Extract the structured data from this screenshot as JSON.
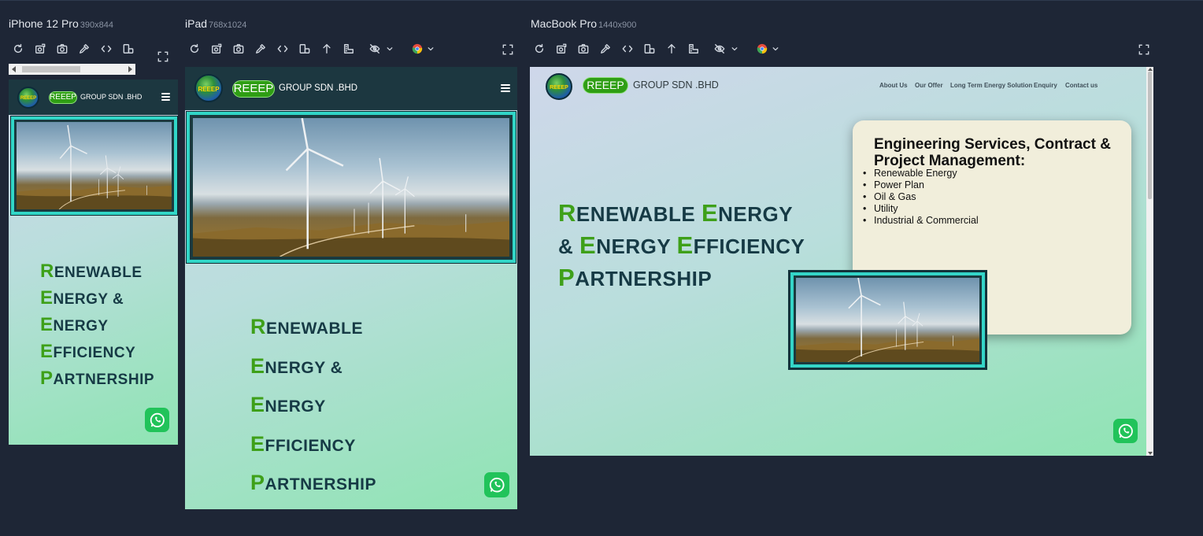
{
  "devices": [
    {
      "name": "iPhone 12 Pro",
      "resolution": "390x844"
    },
    {
      "name": "iPad",
      "resolution": "768x1024"
    },
    {
      "name": "MacBook Pro",
      "resolution": "1440x900"
    }
  ],
  "toolbar_icons": [
    "reload-icon",
    "screenshot-full-icon",
    "camera-icon",
    "eyedropper-icon",
    "code-icon",
    "rotate-icon",
    "scroll-up-icon",
    "ruler-icon",
    "hide-icon",
    "chrome-icon",
    "fullscreen-icon"
  ],
  "site": {
    "logo_text": "REEEP",
    "brand_pill": "REEEP",
    "brand_text": "GROUP SDN .BHD",
    "nav_links": [
      "About Us",
      "Our Offer",
      "Long Term Energy Solution",
      "Enquiry",
      "Contact us"
    ],
    "headline_words": [
      {
        "cap": "R",
        "rest": "ENEWABLE"
      },
      {
        "cap": "E",
        "rest": "NERGY"
      },
      {
        "cap": "&",
        "rest": ""
      },
      {
        "cap": "E",
        "rest": "NERGY"
      },
      {
        "cap": "E",
        "rest": "FFICIENCY"
      },
      {
        "cap": "P",
        "rest": "ARTNERSHIP"
      }
    ],
    "card_title": "Engineering Services, Contract & Project Management:",
    "card_items": [
      "Renewable Energy",
      "Power Plan",
      "Oil & Gas",
      "Utility",
      "Industrial & Commercial"
    ]
  },
  "colors": {
    "app_bg": "#1e2636",
    "navbar": "#1c3740",
    "accent_green": "#3ea019",
    "headline": "#163a45",
    "frame_teal": "#31d6c7",
    "whatsapp": "#21c35a",
    "card_bg": "#f1eedb"
  }
}
